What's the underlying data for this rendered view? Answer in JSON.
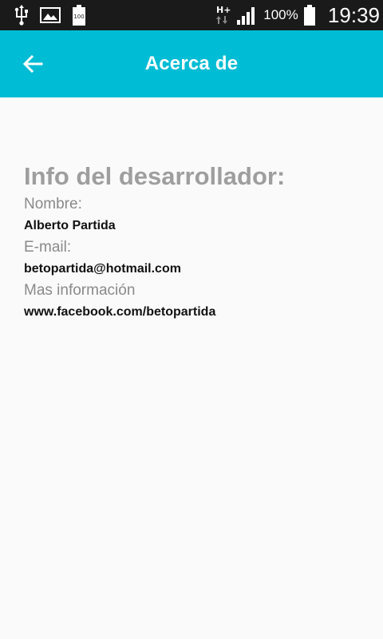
{
  "status_bar": {
    "icons": [
      "usb-icon",
      "gallery-icon",
      "battery-full-icon",
      "hplus-network-icon",
      "signal-icon",
      "battery-icon"
    ],
    "battery_small_label": "100",
    "network_label": "H+",
    "battery_percent": "100%",
    "time": "19:39"
  },
  "app_bar": {
    "background_color": "#00bcd4",
    "back_icon": "arrow-left-icon",
    "title": "Acerca de"
  },
  "developer": {
    "heading": "Info del desarrollador:",
    "name_label": "Nombre:",
    "name_value": "Alberto Partida",
    "email_label": "E-mail:",
    "email_value": "betopartida@hotmail.com",
    "more_label": "Mas información",
    "more_value": "www.facebook.com/betopartida"
  }
}
